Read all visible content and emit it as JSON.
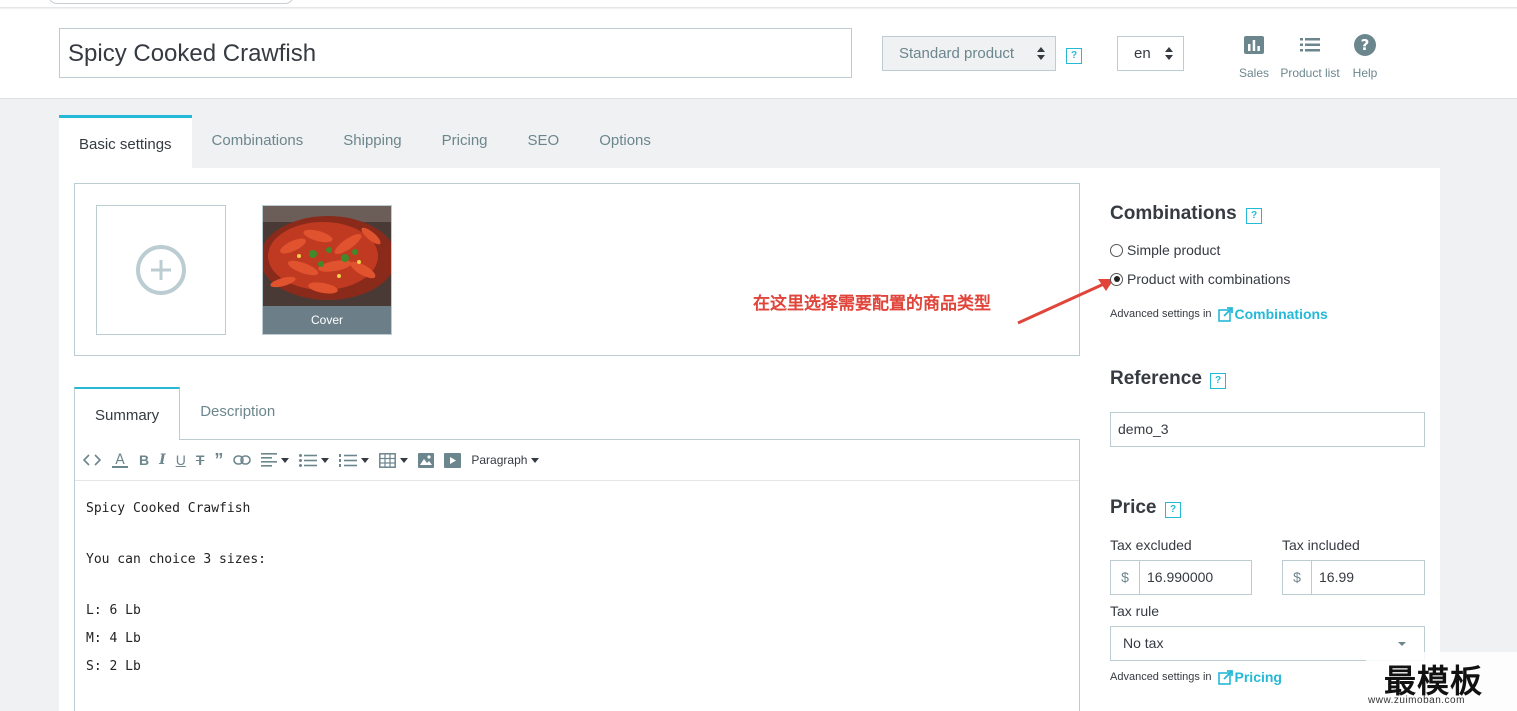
{
  "header": {
    "product_name": "Spicy Cooked Crawfish",
    "product_type": "Standard product",
    "help_mark": "?",
    "language": "en",
    "tools": [
      {
        "label": "Sales",
        "icon": "bar-chart-icon"
      },
      {
        "label": "Product list",
        "icon": "list-icon"
      },
      {
        "label": "Help",
        "icon": "help-circle-icon"
      }
    ]
  },
  "main_tabs": [
    "Basic settings",
    "Combinations",
    "Shipping",
    "Pricing",
    "SEO",
    "Options"
  ],
  "images": {
    "cover_label": "Cover"
  },
  "annotation": "在这里选择需要配置的商品类型",
  "description_tabs": [
    "Summary",
    "Description"
  ],
  "editor": {
    "format_label": "Paragraph",
    "lines": [
      "Spicy Cooked Crawfish",
      "You can choice 3 sizes:",
      "L: 6 Lb",
      "M: 4 Lb",
      "S: 2 Lb"
    ]
  },
  "combinations": {
    "title": "Combinations",
    "options": [
      "Simple product",
      "Product with combinations"
    ],
    "selected_index": 1,
    "advanced_prefix": "Advanced settings in",
    "advanced_link": "Combinations"
  },
  "reference": {
    "title": "Reference",
    "value": "demo_3"
  },
  "price": {
    "title": "Price",
    "tax_excluded_label": "Tax excluded",
    "tax_excluded_value": "16.990000",
    "tax_included_label": "Tax included",
    "tax_included_value": "16.99",
    "currency": "$",
    "tax_rule_label": "Tax rule",
    "tax_rule_value": "No tax",
    "advanced_prefix": "Advanced settings in",
    "advanced_link": "Pricing"
  },
  "watermark": {
    "text": "最模板",
    "url": "www.zuimoban.com"
  },
  "colors": {
    "accent": "#25b9d7",
    "annotation": "#e0443a",
    "border": "#bbcdd2"
  }
}
